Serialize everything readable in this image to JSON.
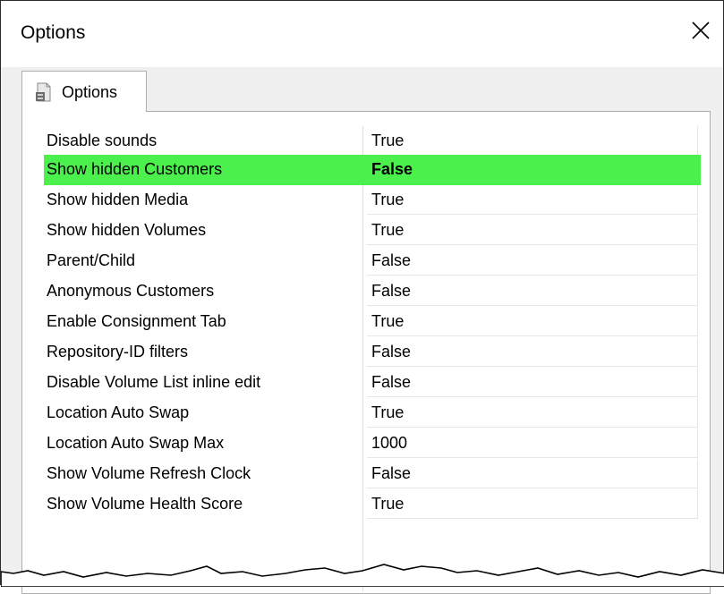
{
  "window": {
    "title": "Options",
    "close_label": "×"
  },
  "tab": {
    "label": "Options",
    "icon": "options-document-icon"
  },
  "options": [
    {
      "name": "Disable sounds",
      "value": "True",
      "selected": false
    },
    {
      "name": "Show hidden Customers",
      "value": "False",
      "selected": true
    },
    {
      "name": "Show hidden Media",
      "value": "True",
      "selected": false
    },
    {
      "name": "Show hidden Volumes",
      "value": "True",
      "selected": false
    },
    {
      "name": "Parent/Child",
      "value": "False",
      "selected": false
    },
    {
      "name": "Anonymous Customers",
      "value": "False",
      "selected": false
    },
    {
      "name": "Enable Consignment Tab",
      "value": "True",
      "selected": false
    },
    {
      "name": "Repository-ID filters",
      "value": "False",
      "selected": false
    },
    {
      "name": "Disable Volume List inline edit",
      "value": "False",
      "selected": false
    },
    {
      "name": "Location Auto Swap",
      "value": "True",
      "selected": false
    },
    {
      "name": "Location Auto Swap Max",
      "value": "1000",
      "selected": false
    },
    {
      "name": "Show Volume Refresh Clock",
      "value": "False",
      "selected": false
    },
    {
      "name": "Show Volume Health Score",
      "value": "True",
      "selected": false
    }
  ],
  "colors": {
    "selected_row": "#4cf04c"
  }
}
